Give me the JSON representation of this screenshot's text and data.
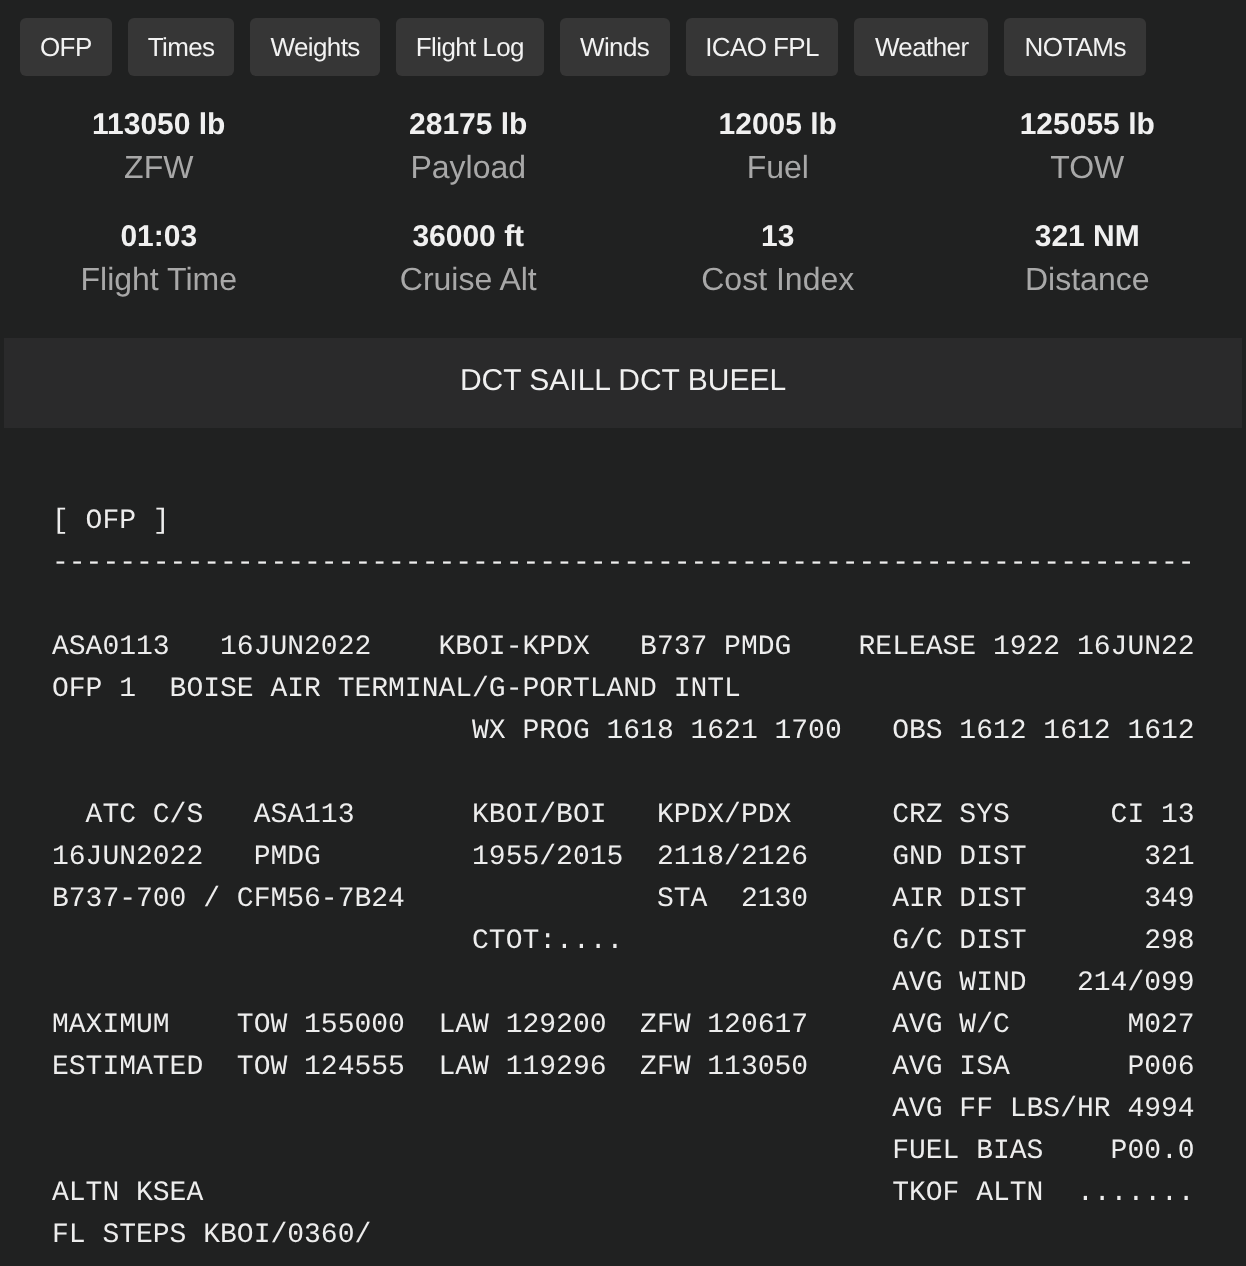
{
  "tabs": [
    {
      "label": "OFP"
    },
    {
      "label": "Times"
    },
    {
      "label": "Weights"
    },
    {
      "label": "Flight Log"
    },
    {
      "label": "Winds"
    },
    {
      "label": "ICAO FPL"
    },
    {
      "label": "Weather"
    },
    {
      "label": "NOTAMs"
    }
  ],
  "stats": [
    {
      "value": "113050 lb",
      "label": "ZFW"
    },
    {
      "value": "28175 lb",
      "label": "Payload"
    },
    {
      "value": "12005 lb",
      "label": "Fuel"
    },
    {
      "value": "125055 lb",
      "label": "TOW"
    },
    {
      "value": "01:03",
      "label": "Flight Time"
    },
    {
      "value": "36000 ft",
      "label": "Cruise Alt"
    },
    {
      "value": "13",
      "label": "Cost Index"
    },
    {
      "value": "321 NM",
      "label": "Distance"
    }
  ],
  "route": "DCT SAILL DCT BUEEL",
  "ofp_text": "[ OFP ]\n--------------------------------------------------------------------\n\nASA0113   16JUN2022    KBOI-KPDX   B737 PMDG    RELEASE 1922 16JUN22\nOFP 1  BOISE AIR TERMINAL/G-PORTLAND INTL\n                         WX PROG 1618 1621 1700   OBS 1612 1612 1612\n\n  ATC C/S   ASA113       KBOI/BOI   KPDX/PDX      CRZ SYS      CI 13\n16JUN2022   PMDG         1955/2015  2118/2126     GND DIST       321\nB737-700 / CFM56-7B24               STA  2130     AIR DIST       349\n                         CTOT:....                G/C DIST       298\n                                                  AVG WIND   214/099\nMAXIMUM    TOW 155000  LAW 129200  ZFW 120617     AVG W/C       M027\nESTIMATED  TOW 124555  LAW 119296  ZFW 113050     AVG ISA       P006\n                                                  AVG FF LBS/HR 4994\n                                                  FUEL BIAS    P00.0\nALTN KSEA                                         TKOF ALTN  .......\nFL STEPS KBOI/0360/"
}
